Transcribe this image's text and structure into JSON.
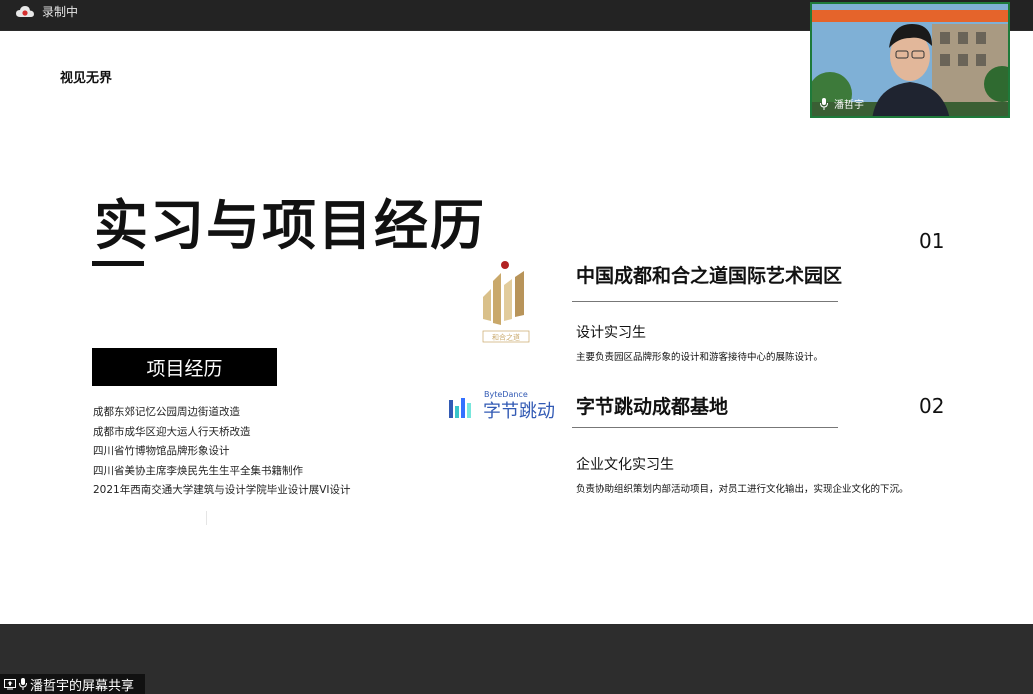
{
  "recording": {
    "status": "录制中"
  },
  "slide": {
    "brand": "视见无界",
    "title": "实习与项目经历",
    "projects": {
      "heading": "项目经历",
      "items": [
        "成都东郊记忆公园周边街道改造",
        "成都市成华区迎大运人行天桥改造",
        "四川省竹博物馆品牌形象设计",
        "四川省美协主席李焕民先生生平全集书籍制作",
        "2021年西南交通大学建筑与设计学院毕业设计展VI设计"
      ]
    },
    "experiences": [
      {
        "number": "01",
        "company": "中国成都和合之道国际艺术园区",
        "role": "设计实习生",
        "description": "主要负责园区品牌形象的设计和游客接待中心的展陈设计。",
        "logo_caption": "和合之道"
      },
      {
        "number": "02",
        "company": "字节跳动成都基地",
        "role": "企业文化实习生",
        "description": "负责协助组织策划内部活动项目，对员工进行文化输出，实现企业文化的下沉。",
        "logo_small": "ByteDance",
        "logo_text": "字节跳动"
      }
    ]
  },
  "webcam": {
    "name": "潘哲宇"
  },
  "share": {
    "label": "潘哲宇的屏幕共享"
  },
  "colors": {
    "logo_gold": "#c9a86a",
    "logo_red": "#b22222",
    "bytedance_blue": "#3370ff",
    "bytedance_dark": "#325ab4",
    "bytedance_teal": "#3ac5c9"
  }
}
